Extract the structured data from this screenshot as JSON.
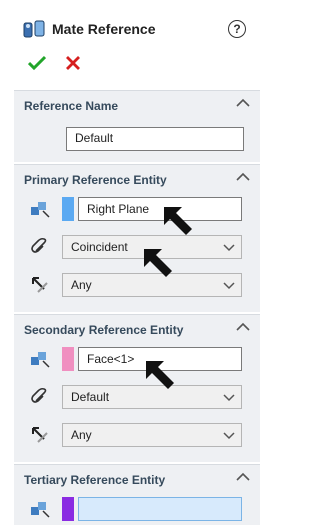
{
  "panel": {
    "title": "Mate Reference",
    "help_label": "?",
    "icons": {
      "title": "mate-reference-icon",
      "help": "help-icon",
      "ok": "check-icon",
      "cancel": "close-icon",
      "collapse": "chevron-up-icon",
      "entity": "select-entity-icon",
      "mate_type": "paperclip-icon",
      "alignment": "alignment-arrow-icon",
      "caret": "chevron-down-icon",
      "annotation": "black-arrow-pointer"
    }
  },
  "reference_name": {
    "title": "Reference Name",
    "value": "Default"
  },
  "primary": {
    "title": "Primary Reference Entity",
    "entity": "Right Plane",
    "entity_color": "#5aa9f2",
    "mate_type": "Coincident",
    "alignment": "Any"
  },
  "secondary": {
    "title": "Secondary Reference Entity",
    "entity": "Face<1>",
    "entity_color": "#f08fc0",
    "mate_type": "Default",
    "alignment": "Any"
  },
  "tertiary": {
    "title": "Tertiary Reference Entity",
    "entity": "",
    "entity_color": "#8a2be2"
  },
  "colors": {
    "ok": "#22a52a",
    "cancel": "#d61f1f",
    "group_bg": "#eef0f3",
    "group_title": "#364a5c"
  }
}
